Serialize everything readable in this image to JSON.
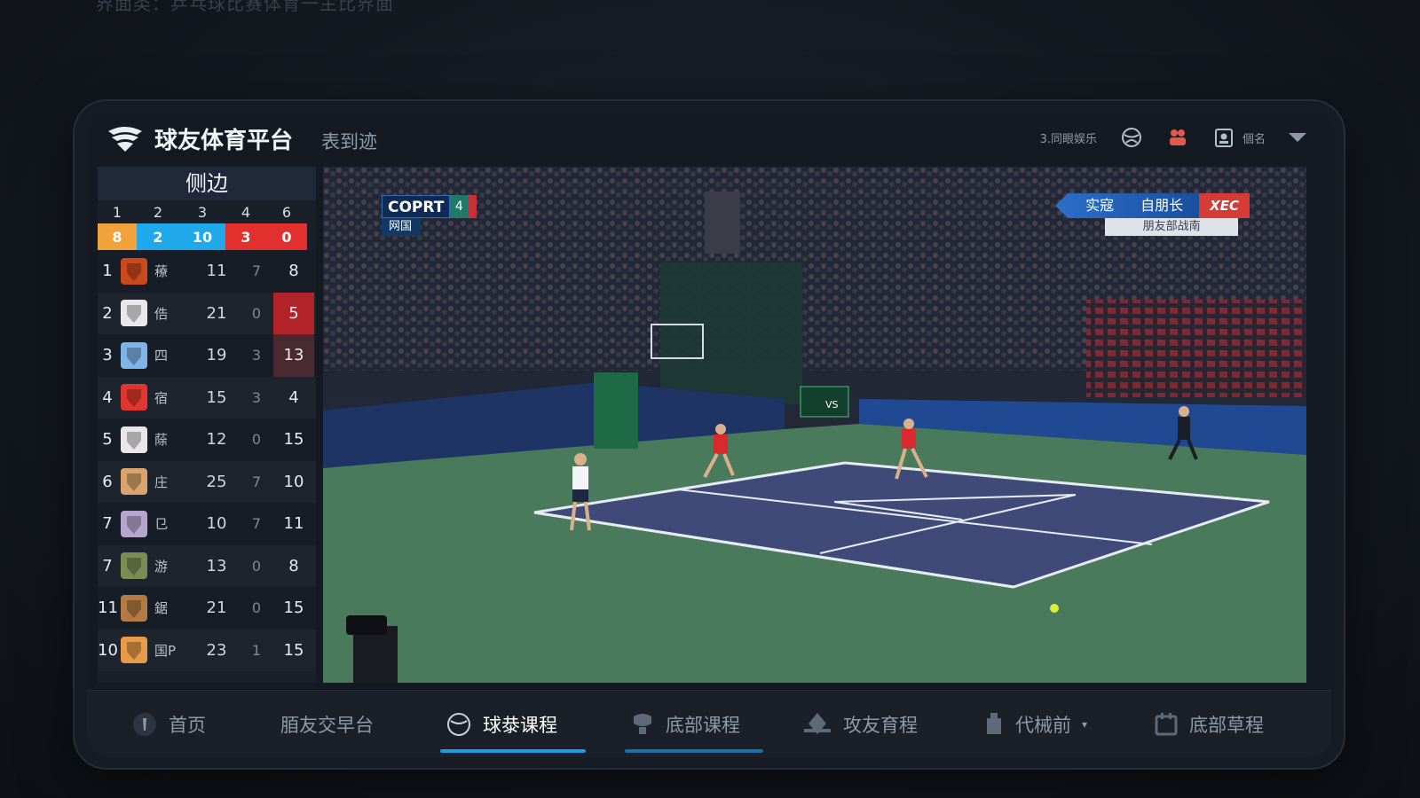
{
  "caption": "界面类：乒乓球比赛体育一主比界面",
  "header": {
    "brand": "球友体育平台",
    "subtitle": "表到迹",
    "status": "3.同眼娱乐",
    "user": "個名"
  },
  "sidebar": {
    "title": "侧边",
    "columns": [
      "1",
      "2",
      "3",
      "4",
      "6"
    ],
    "score": [
      {
        "value": "8",
        "color": "#f2a23a"
      },
      {
        "value": "2",
        "color": "#1fa8ea"
      },
      {
        "value": "10",
        "color": "#1fa8ea"
      },
      {
        "value": "3",
        "color": "#e2302e"
      },
      {
        "value": "0",
        "color": "#e2302e"
      }
    ],
    "rows": [
      {
        "rank": "1",
        "name": "䕩",
        "pts": "11",
        "d": "7",
        "x": "8",
        "crest": "#c94a1c",
        "hl": ""
      },
      {
        "rank": "2",
        "name": "俈",
        "pts": "21",
        "d": "0",
        "x": "5",
        "crest": "#e8e8ec",
        "hl": "#b3232a"
      },
      {
        "rank": "3",
        "name": "四",
        "pts": "19",
        "d": "3",
        "x": "13",
        "crest": "#7fb4e6",
        "hl": "#4a2a31"
      },
      {
        "rank": "4",
        "name": "宿",
        "pts": "15",
        "d": "3",
        "x": "4",
        "crest": "#e0362f",
        "hl": ""
      },
      {
        "rank": "5",
        "name": "蒢",
        "pts": "12",
        "d": "0",
        "x": "15",
        "crest": "#e9e6ea",
        "hl": ""
      },
      {
        "rank": "6",
        "name": "庄",
        "pts": "25",
        "d": "7",
        "x": "10",
        "crest": "#d9a46b",
        "hl": ""
      },
      {
        "rank": "7",
        "name": "㔾",
        "pts": "10",
        "d": "7",
        "x": "11",
        "crest": "#b5a6cf",
        "hl": ""
      },
      {
        "rank": "7",
        "name": "游",
        "pts": "13",
        "d": "0",
        "x": "8",
        "crest": "#7c8d54",
        "hl": ""
      },
      {
        "rank": "11",
        "name": "鋸",
        "pts": "21",
        "d": "0",
        "x": "15",
        "crest": "#b47a43",
        "hl": ""
      },
      {
        "rank": "10",
        "name": "国P",
        "pts": "23",
        "d": "1",
        "x": "15",
        "crest": "#e79a47",
        "hl": ""
      }
    ]
  },
  "video": {
    "court_label": "COPRT",
    "court_num": "4",
    "court_sub": "网国",
    "match_left": "实寇",
    "match_right": "自朋长",
    "match_badge": "XEC",
    "match_sub": "朋友部战南",
    "board_text": "VS"
  },
  "nav": {
    "items": [
      {
        "label": "首页",
        "icon": "home-icon"
      },
      {
        "label": "脜友交早台",
        "icon": ""
      },
      {
        "label": "球㳟课程",
        "icon": "ball-icon"
      },
      {
        "label": "底部课程",
        "icon": "course-icon"
      },
      {
        "label": "攻友育程",
        "icon": "club-icon"
      },
      {
        "label": "代械前",
        "icon": "shop-icon"
      },
      {
        "label": "底部草程",
        "icon": "calendar-icon"
      }
    ]
  }
}
